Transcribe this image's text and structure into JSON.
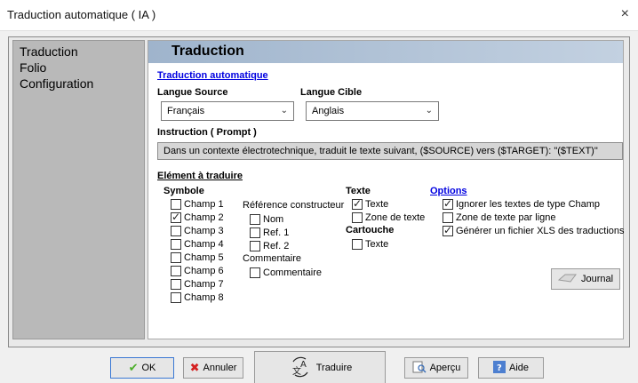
{
  "window": {
    "title": "Traduction automatique ( IA )",
    "close": "×"
  },
  "sidebar": {
    "items": [
      {
        "label": "Traduction"
      },
      {
        "label": "Folio"
      },
      {
        "label": "Configuration"
      }
    ]
  },
  "header": {
    "title": "Traduction"
  },
  "auto": {
    "section_title": "Traduction automatique",
    "source_label": "Langue Source",
    "source_value": "Français",
    "target_label": "Langue Cible",
    "target_value": "Anglais",
    "prompt_label": "Instruction ( Prompt )",
    "prompt_value": "Dans un contexte électrotechnique, traduit le texte suivant, ($SOURCE) vers ($TARGET): \"($TEXT)\""
  },
  "elements": {
    "section_title": "Elément à traduire",
    "symbole": {
      "title": "Symbole",
      "champs": [
        {
          "label": "Champ 1",
          "checked": false
        },
        {
          "label": "Champ 2",
          "checked": true
        },
        {
          "label": "Champ 3",
          "checked": false
        },
        {
          "label": "Champ 4",
          "checked": false
        },
        {
          "label": "Champ 5",
          "checked": false
        },
        {
          "label": "Champ 6",
          "checked": false
        },
        {
          "label": "Champ 7",
          "checked": false
        },
        {
          "label": "Champ 8",
          "checked": false
        }
      ],
      "ref_title": "Référence constructeur",
      "refs": [
        {
          "label": "Nom",
          "checked": false
        },
        {
          "label": "Ref. 1",
          "checked": false
        },
        {
          "label": "Ref. 2",
          "checked": false
        }
      ],
      "comment_title": "Commentaire",
      "comment": {
        "label": "Commentaire",
        "checked": false
      }
    },
    "texte": {
      "title": "Texte",
      "items": [
        {
          "label": "Texte",
          "checked": true
        },
        {
          "label": "Zone de texte",
          "checked": false
        }
      ]
    },
    "cartouche": {
      "title": "Cartouche",
      "items": [
        {
          "label": "Texte",
          "checked": false
        }
      ]
    },
    "options": {
      "title": "Options",
      "items": [
        {
          "label": "Ignorer les textes de type Champ",
          "checked": true
        },
        {
          "label": "Zone de texte par ligne",
          "checked": false
        },
        {
          "label": "Générer un fichier XLS des traductions",
          "checked": true
        }
      ]
    },
    "journal_label": "Journal"
  },
  "buttons": {
    "ok": "OK",
    "cancel": "Annuler",
    "translate": "Traduire",
    "preview": "Aperçu",
    "help": "Aide"
  }
}
